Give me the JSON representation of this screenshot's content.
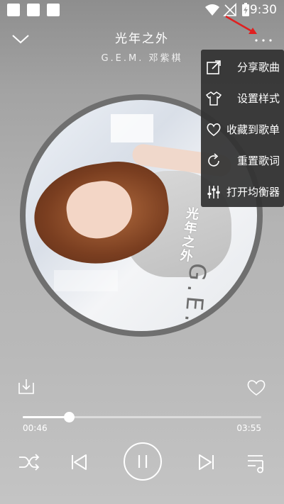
{
  "status_bar": {
    "time": "9:30"
  },
  "header": {
    "title": "光年之外",
    "artist": "G.E.M. 邓紫棋"
  },
  "album_art": {
    "vertical_title": "光年之外",
    "overlay_text": "G.E.M."
  },
  "menu": {
    "items": [
      {
        "label": "分享歌曲",
        "icon": "share-icon"
      },
      {
        "label": "设置样式",
        "icon": "shirt-icon"
      },
      {
        "label": "收藏到歌单",
        "icon": "heart-icon"
      },
      {
        "label": "重置歌词",
        "icon": "refresh-icon"
      },
      {
        "label": "打开均衡器",
        "icon": "equalizer-icon"
      }
    ]
  },
  "player": {
    "elapsed": "00:46",
    "total": "03:55",
    "progress_fraction": 0.196,
    "state": "playing"
  },
  "colors": {
    "accent_arrow": "#e02020",
    "menu_bg": "#323232"
  }
}
